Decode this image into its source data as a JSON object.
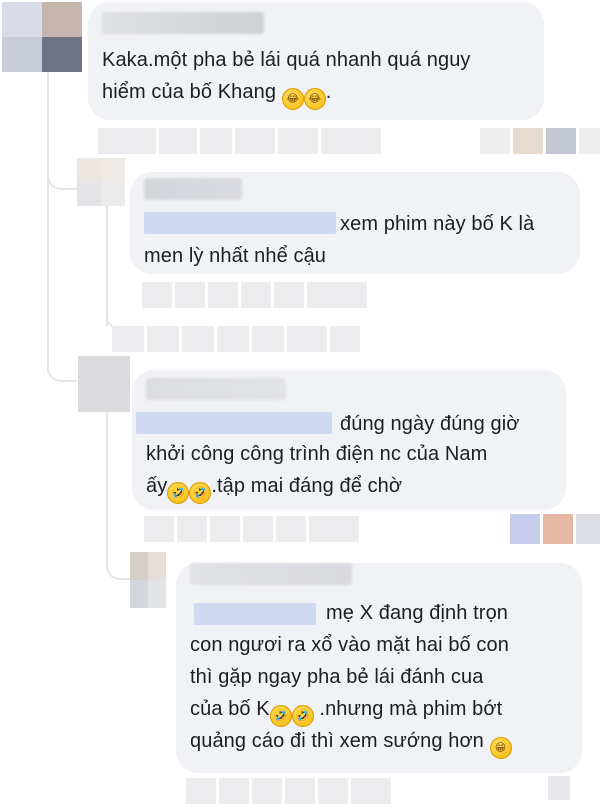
{
  "comments": [
    {
      "id": "c1",
      "text_lines": [
        "Kaka.một pha bẻ lái quá nhanh quá nguy",
        "hiểm của bố Khang ",
        "."
      ],
      "emojis": [
        "😂",
        "😂"
      ]
    },
    {
      "id": "c2",
      "text_lines": [
        "xem phim này bố K là",
        "men lỳ nhất nhể cậu"
      ]
    },
    {
      "id": "c3",
      "text_lines": [
        "đúng ngày đúng giờ",
        "khởi công công trình điện nc của Nam",
        "ấy",
        ".tập mai đáng để chờ"
      ],
      "emojis": [
        "🤣",
        "🤣"
      ]
    },
    {
      "id": "c4",
      "text_lines": [
        "mẹ X đang định trọn",
        "con ngươi ra xổ vào mặt hai bố con",
        "thì gặp ngay pha bẻ lái đánh cua",
        "của bố K",
        " .nhưng mà phim bớt",
        "quảng cáo đi thì xem sướng hơn "
      ],
      "emojis": [
        "🤣",
        "🤣",
        "😁"
      ]
    }
  ],
  "colors": {
    "bubble": "#f0f2f5",
    "thread": "#e4e6ea",
    "text": "#1c1e21"
  }
}
